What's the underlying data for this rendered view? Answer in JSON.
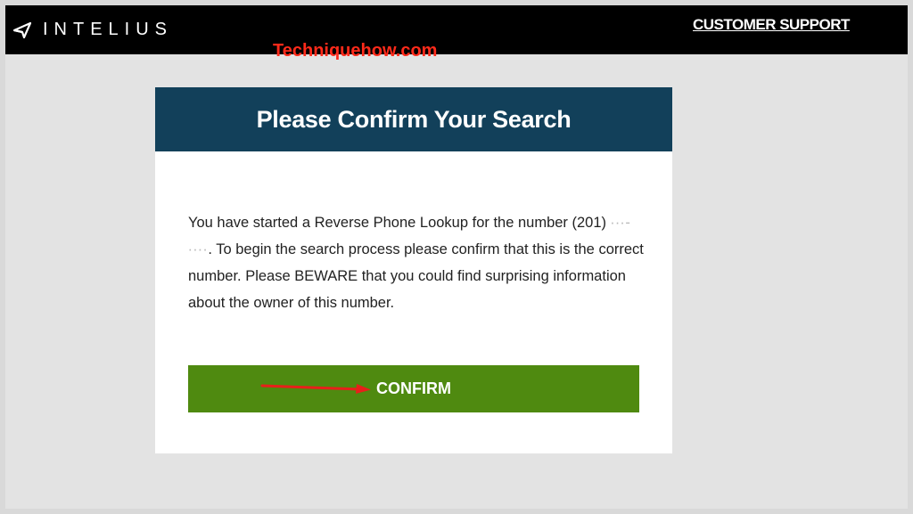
{
  "header": {
    "logo_text": "INTELIUS",
    "support_link": "CUSTOMER SUPPORT"
  },
  "watermark": "Techniquehow.com",
  "dialog": {
    "title": "Please Confirm Your Search",
    "message_part1": "You have started a Reverse Phone Lookup for the number (201) ",
    "masked_number": "∙∙∙-∙∙∙∙",
    "message_part2": ". To begin the search process please confirm that this is the correct number. Please BEWARE that you could find surprising information about the owner of this number.",
    "confirm_label": "CONFIRM"
  },
  "colors": {
    "header_bg": "#000000",
    "card_header_bg": "#12405a",
    "confirm_bg": "#4f8a10",
    "watermark": "#ff2a1a",
    "arrow": "#e8201a"
  },
  "icons": {
    "logo": "intelius-logo-icon",
    "arrow": "red-arrow-annotation"
  }
}
